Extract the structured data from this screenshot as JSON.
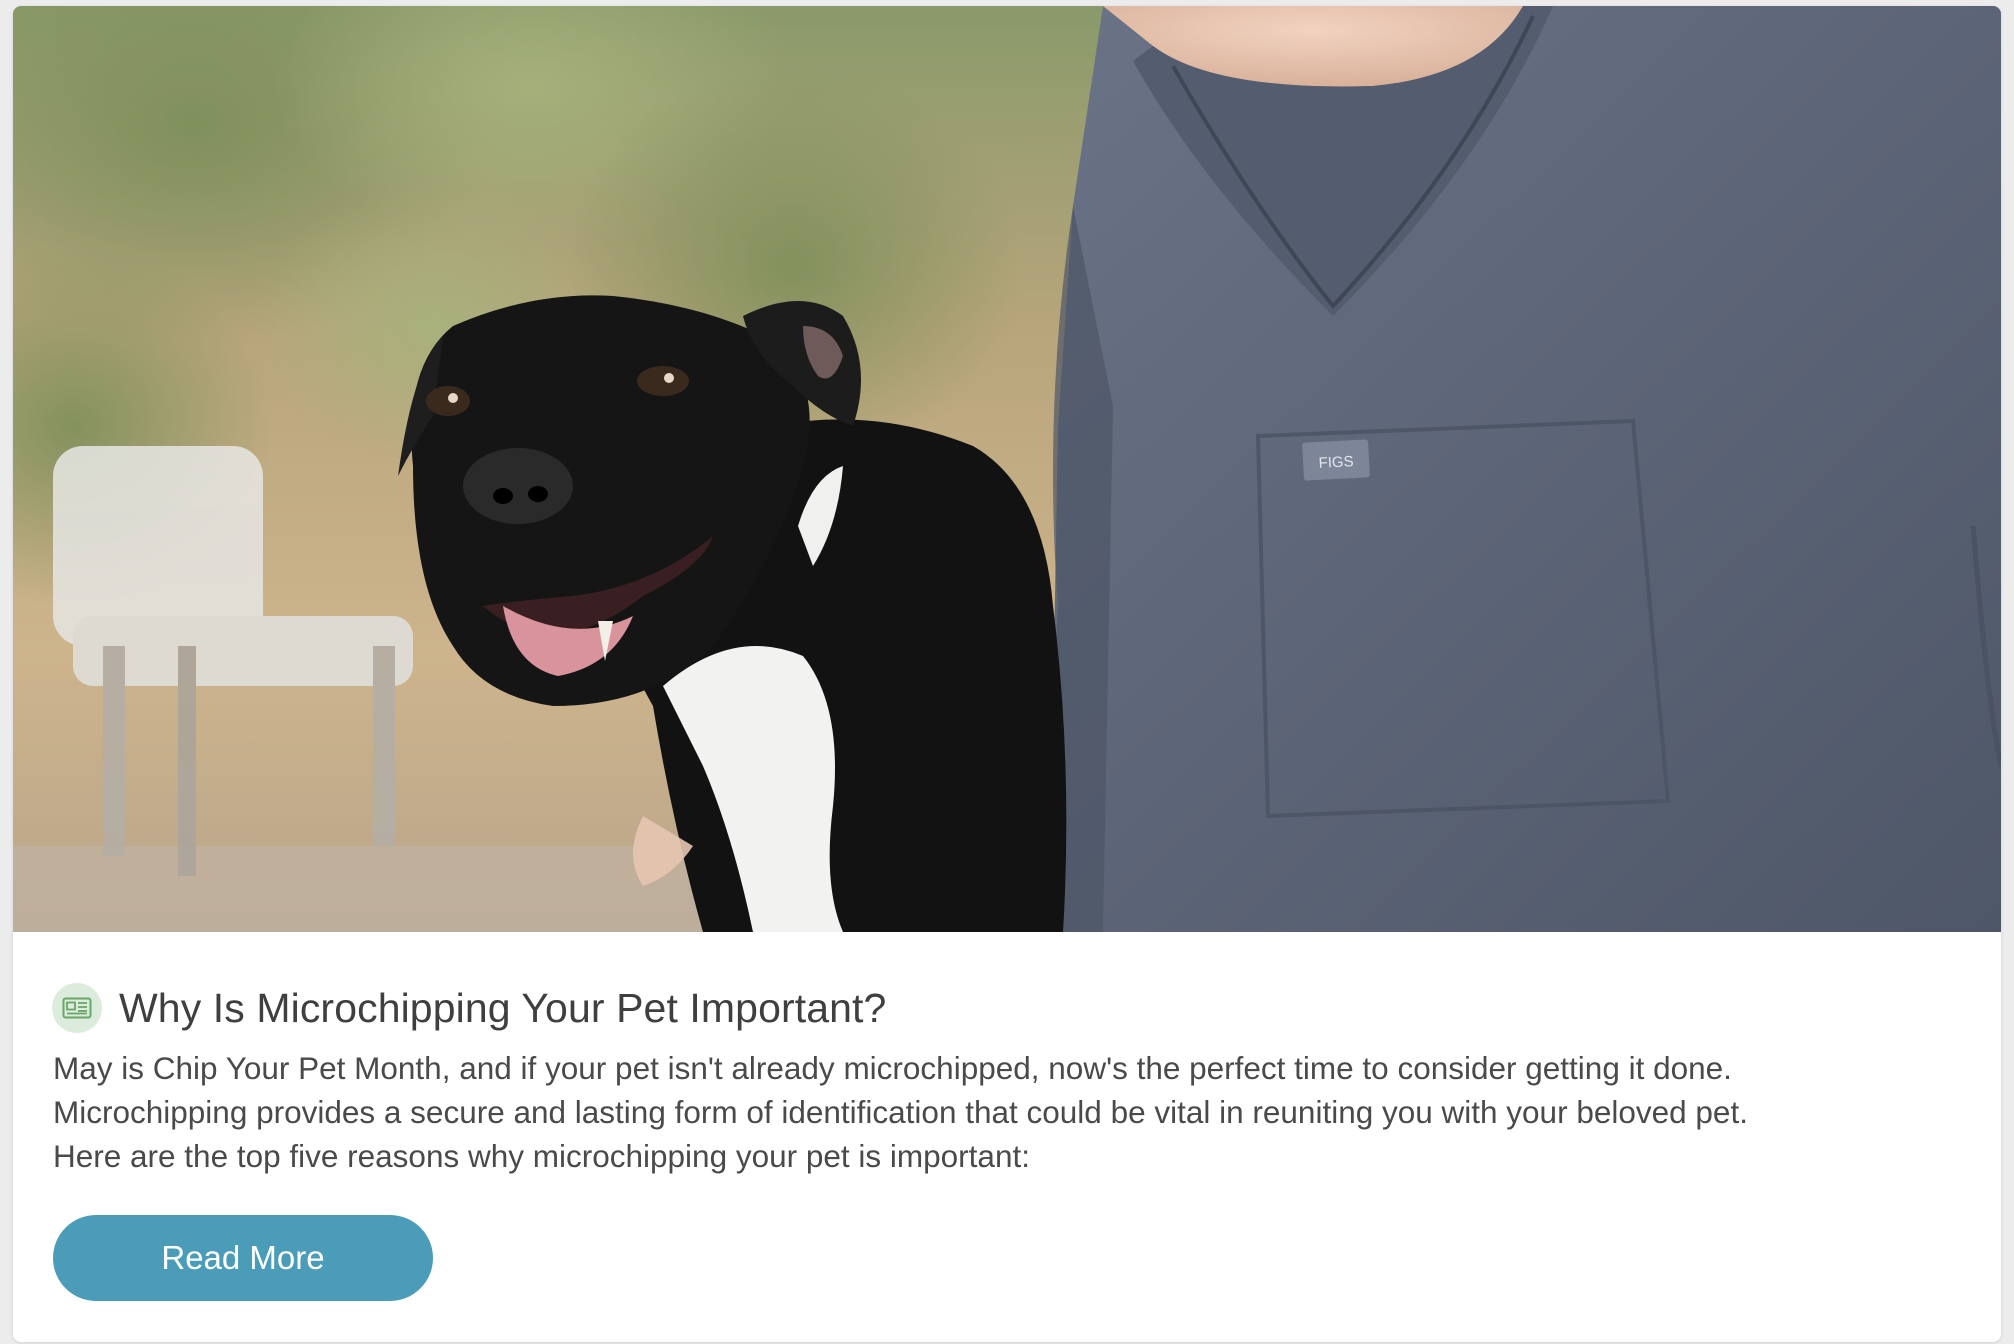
{
  "post": {
    "title": "Why Is Microchipping Your Pet Important?",
    "body_lines": [
      "May is Chip Your Pet Month, and if your pet isn't already microchipped, now's the perfect time to consider getting it done.",
      "Microchipping provides a secure and lasting form of identification that could be vital in reuniting you with your beloved pet.",
      "Here are the top five reasons why microchipping your pet is important:"
    ],
    "read_more_label": "Read More",
    "title_icon": "newspaper-icon",
    "scrub_tag": "FIGS"
  },
  "colors": {
    "button": "#4a9cb9",
    "icon_bg": "#dcecdc",
    "icon_fg": "#6aa66a",
    "title": "#3f3f3f",
    "body": "#4a4a4a"
  }
}
